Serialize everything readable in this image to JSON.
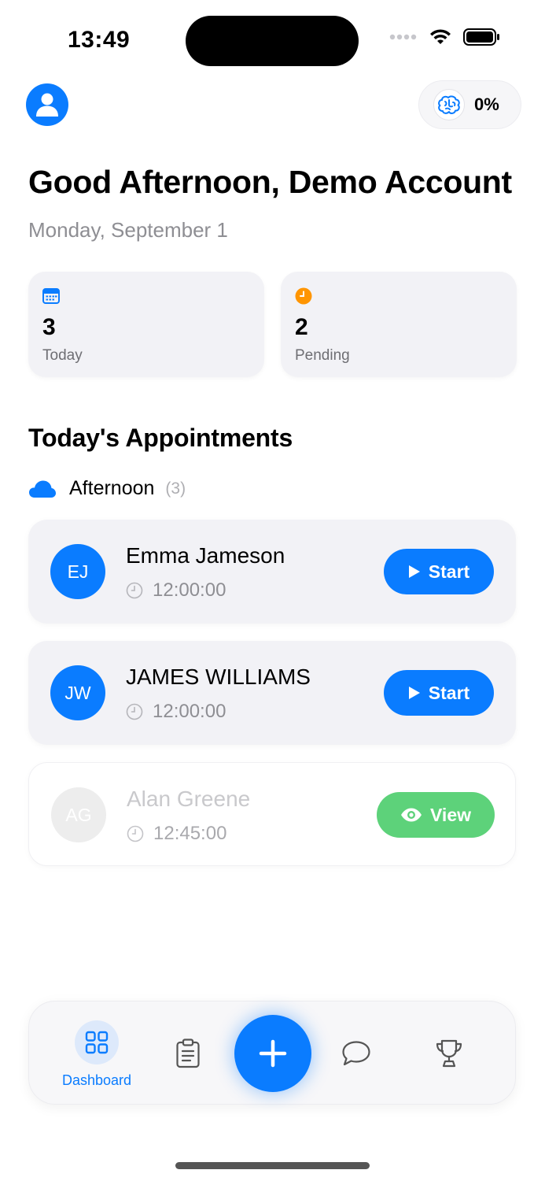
{
  "status_bar": {
    "time": "13:49"
  },
  "header": {
    "ai_percent": "0%"
  },
  "greeting": "Good Afternoon, Demo Account",
  "date": "Monday, September 1",
  "stats": [
    {
      "value": "3",
      "label": "Today",
      "icon": "calendar-icon",
      "color": "#0a7cff"
    },
    {
      "value": "2",
      "label": "Pending",
      "icon": "clock-icon",
      "color": "#ff9500"
    }
  ],
  "appointments_section": {
    "title": "Today's Appointments",
    "period": {
      "label": "Afternoon",
      "count": "(3)",
      "icon": "cloud-icon"
    },
    "items": [
      {
        "initials": "EJ",
        "name": "Emma Jameson",
        "time": "12:00:00",
        "action": "Start"
      },
      {
        "initials": "JW",
        "name": "JAMES WILLIAMS",
        "time": "12:00:00",
        "action": "Start"
      },
      {
        "initials": "AG",
        "name": "Alan Greene",
        "time": "12:45:00",
        "action": "View"
      }
    ]
  },
  "tabbar": {
    "dashboard_label": "Dashboard",
    "items": [
      "dashboard-icon",
      "clipboard-icon",
      "plus-icon",
      "chat-icon",
      "trophy-icon"
    ]
  },
  "colors": {
    "accent": "#0a7cff",
    "pending": "#ff9500",
    "view": "#5dd27a"
  }
}
